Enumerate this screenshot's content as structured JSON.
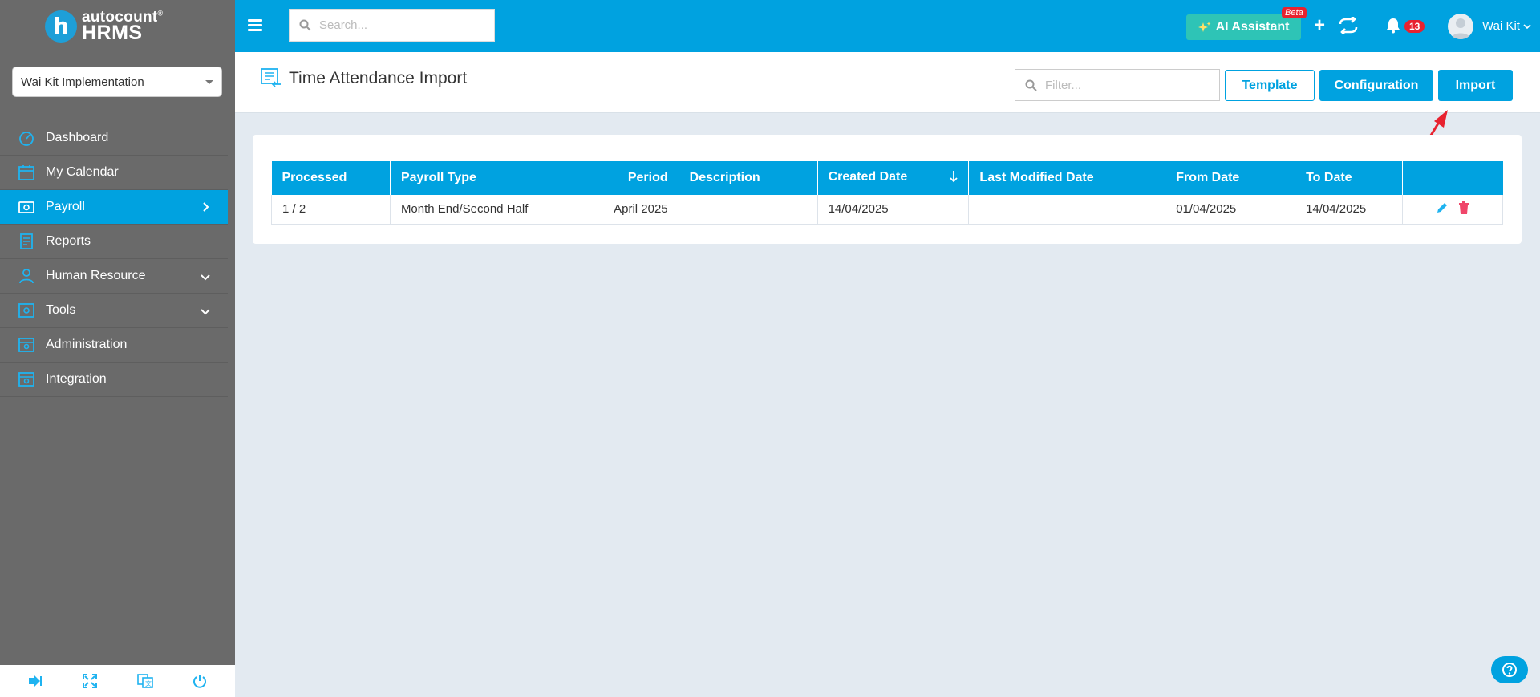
{
  "brand": {
    "top": "autocount",
    "bottom": "HRMS"
  },
  "company": {
    "selected": "Wai Kit Implementation"
  },
  "sidebar": {
    "items": [
      {
        "label": "Dashboard"
      },
      {
        "label": "My Calendar"
      },
      {
        "label": "Payroll"
      },
      {
        "label": "Reports"
      },
      {
        "label": "Human Resource"
      },
      {
        "label": "Tools"
      },
      {
        "label": "Administration"
      },
      {
        "label": "Integration"
      }
    ]
  },
  "topbar": {
    "search_placeholder": "Search...",
    "ai_label": "AI Assistant",
    "beta": "Beta",
    "notifications": "13",
    "user": "Wai Kit"
  },
  "page": {
    "title": "Time Attendance Import",
    "filter_placeholder": "Filter...",
    "template_label": "Template",
    "configuration_label": "Configuration",
    "import_label": "Import"
  },
  "table": {
    "headers": [
      "Processed",
      "Payroll Type",
      "Period",
      "Description",
      "Created Date",
      "Last Modified Date",
      "From Date",
      "To Date",
      ""
    ],
    "rows": [
      [
        "1 / 2",
        "Month End/Second Half",
        "April 2025",
        "",
        "14/04/2025",
        "",
        "01/04/2025",
        "14/04/2025"
      ]
    ]
  },
  "colors": {
    "accent": "#00a2e0",
    "sidebar": "#6a6a6a",
    "ai": "#2ec4b6",
    "badge": "#e8222f"
  }
}
